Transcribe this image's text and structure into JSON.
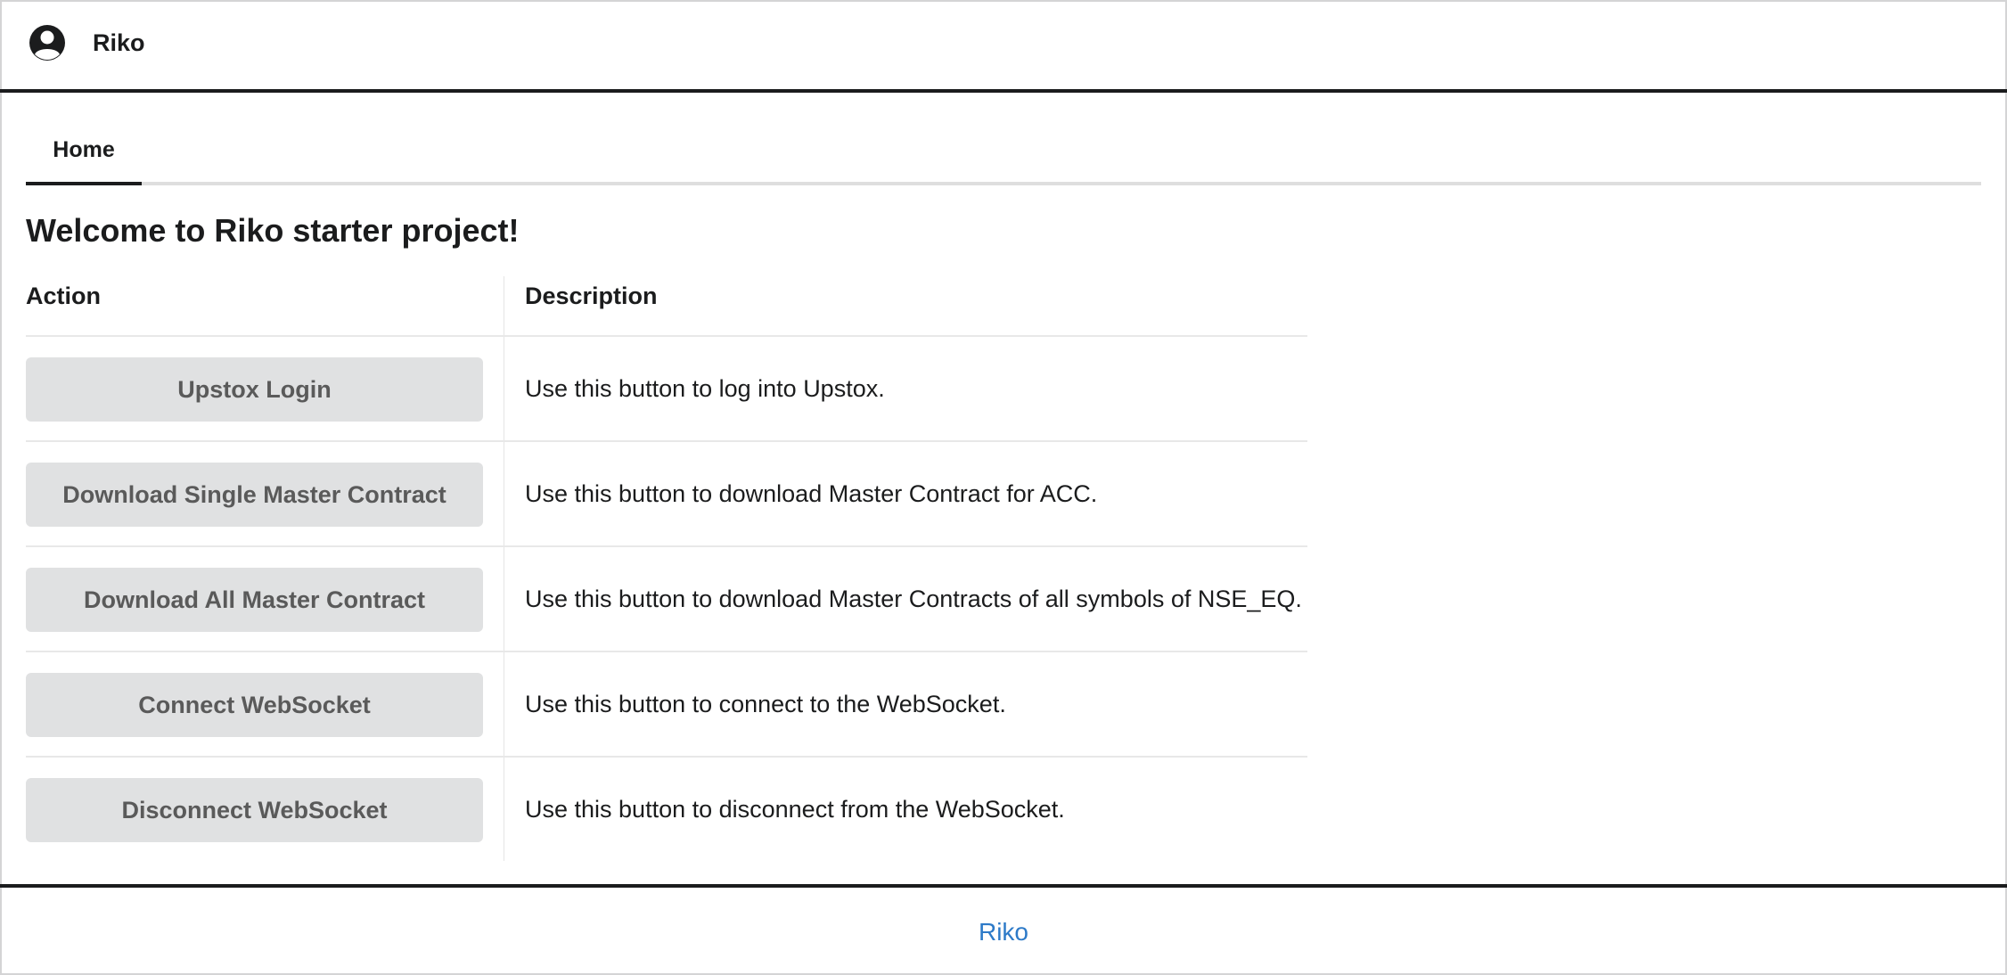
{
  "header": {
    "brand": "Riko",
    "avatar_icon": "user-circle-icon"
  },
  "tabs": [
    {
      "label": "Home",
      "active": true
    }
  ],
  "main": {
    "title": "Welcome to Riko starter project!",
    "table": {
      "columns": [
        "Action",
        "Description"
      ],
      "rows": [
        {
          "action": "Upstox Login",
          "description": "Use this button to log into Upstox."
        },
        {
          "action": "Download Single Master Contract",
          "description": "Use this button to download Master Contract for ACC."
        },
        {
          "action": "Download All Master Contract",
          "description": "Use this button to download Master Contracts of all symbols of NSE_EQ."
        },
        {
          "action": "Connect WebSocket",
          "description": "Use this button to connect to the WebSocket."
        },
        {
          "action": "Disconnect WebSocket",
          "description": "Use this button to disconnect from the WebSocket."
        }
      ]
    }
  },
  "footer": {
    "link": "Riko"
  },
  "colors": {
    "accent": "#2d7ac8",
    "button_bg": "#e0e1e2",
    "header_border": "#1b1c1d"
  }
}
